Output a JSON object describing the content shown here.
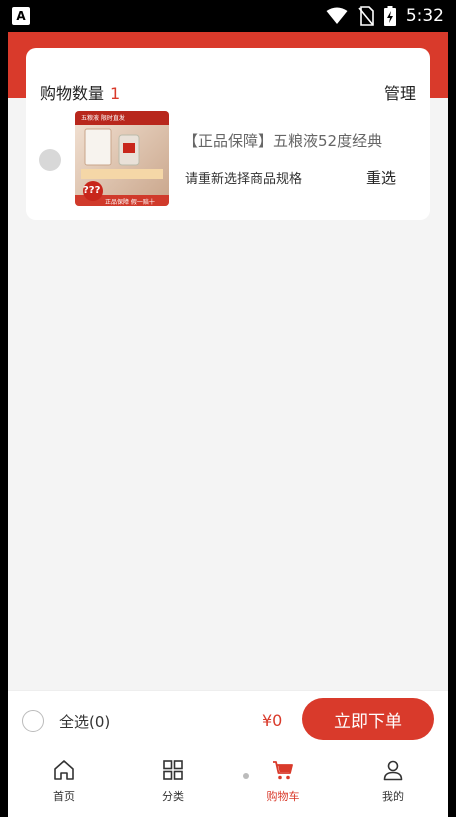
{
  "status_bar": {
    "left_icon_label": "A",
    "time": "5:32",
    "icons": [
      "wifi-icon",
      "no-sim-icon",
      "battery-charging-icon"
    ]
  },
  "cart": {
    "title": "购物数量",
    "count": "1",
    "manage_label": "管理",
    "item": {
      "title": "【正品保障】五粮液52度经典",
      "spec_notice": "请重新选择商品规格",
      "reselect_label": "重选",
      "thumb": {
        "top_badge": "五粮液 限时直发",
        "mid_text": "???",
        "footer_text": "正品保障 假一赔十"
      }
    }
  },
  "checkout": {
    "select_all_label": "全选(0)",
    "total": "¥0",
    "order_button": "立即下单"
  },
  "tabs": [
    {
      "label": "首页",
      "icon": "home-icon",
      "active": false
    },
    {
      "label": "分类",
      "icon": "grid-icon",
      "active": false
    },
    {
      "label": "购物车",
      "icon": "cart-icon",
      "active": true
    },
    {
      "label": "我的",
      "icon": "user-icon",
      "active": false
    }
  ],
  "colors": {
    "accent": "#d93a2b",
    "background": "#f4f4f4"
  }
}
